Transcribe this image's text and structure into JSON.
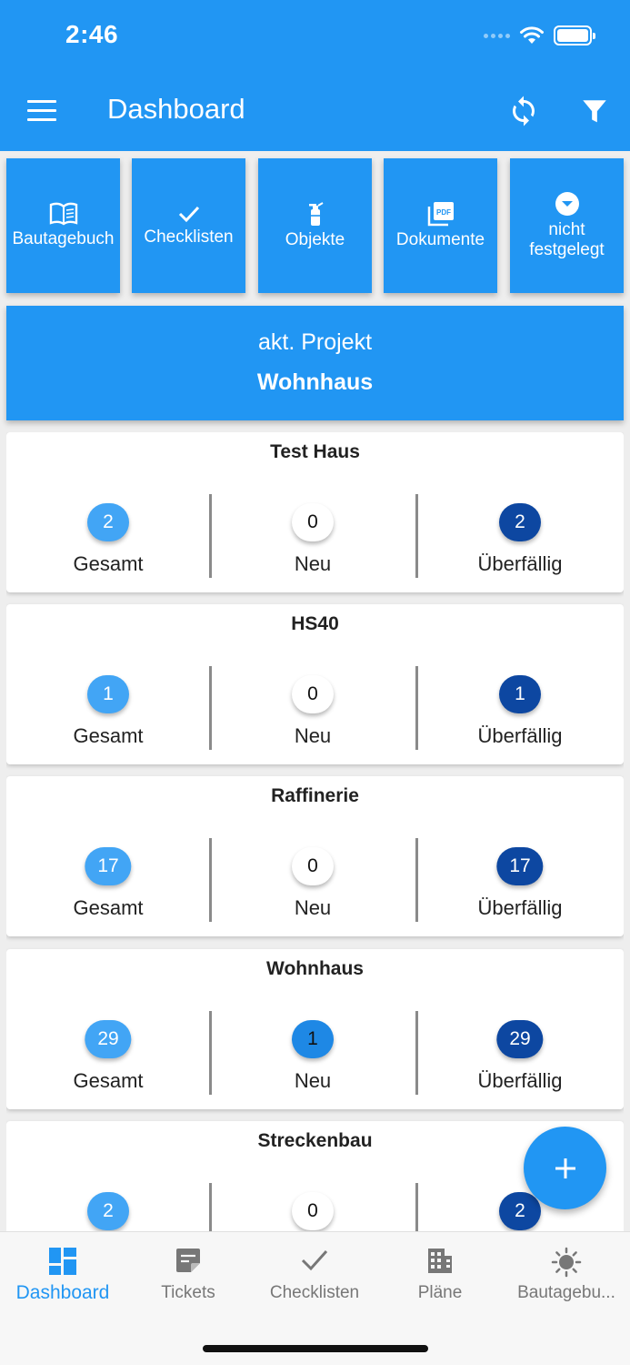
{
  "status_bar": {
    "time": "2:46"
  },
  "header": {
    "title": "Dashboard"
  },
  "tiles": [
    {
      "label": "Bautagebuch",
      "icon": "book-icon"
    },
    {
      "label": "Checklisten",
      "icon": "check-icon"
    },
    {
      "label": "Objekte",
      "icon": "fire-extinguisher-icon"
    },
    {
      "label": "Dokumente",
      "icon": "pdf-icon"
    },
    {
      "label": "nicht festgelegt",
      "icon": "dropdown-circle-icon"
    }
  ],
  "project_banner": {
    "label": "akt. Projekt",
    "name": "Wohnhaus"
  },
  "stat_labels": {
    "total": "Gesamt",
    "new": "Neu",
    "overdue": "Überfällig"
  },
  "projects": [
    {
      "name": "Test Haus",
      "total": "2",
      "new": "0",
      "overdue": "2"
    },
    {
      "name": "HS40",
      "total": "1",
      "new": "0",
      "overdue": "1"
    },
    {
      "name": "Raffinerie",
      "total": "17",
      "new": "0",
      "overdue": "17"
    },
    {
      "name": "Wohnhaus",
      "total": "29",
      "new": "1",
      "overdue": "29"
    },
    {
      "name": "Streckenbau",
      "total": "2",
      "new": "0",
      "overdue": "2"
    }
  ],
  "bottom_nav": [
    {
      "label": "Dashboard",
      "icon": "dashboard-icon",
      "active": true
    },
    {
      "label": "Tickets",
      "icon": "ticket-icon",
      "active": false
    },
    {
      "label": "Checklisten",
      "icon": "check-icon",
      "active": false
    },
    {
      "label": "Pläne",
      "icon": "building-icon",
      "active": false
    },
    {
      "label": "Bautagebu...",
      "icon": "sun-icon",
      "active": false
    }
  ],
  "colors": {
    "primary": "#2196f3",
    "badge_total": "#42a5f5",
    "badge_new_active": "#1e88e5",
    "badge_overdue": "#0d47a1"
  }
}
